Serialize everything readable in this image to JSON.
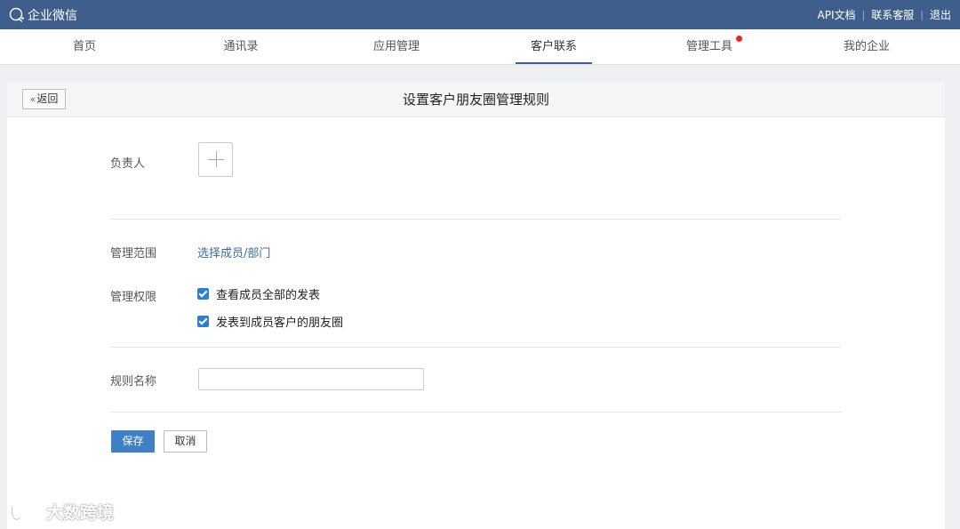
{
  "topbar": {
    "brand": "企业微信",
    "links": [
      "API文档",
      "联系客服",
      "退出"
    ]
  },
  "nav": {
    "items": [
      "首页",
      "通讯录",
      "应用管理",
      "客户联系",
      "管理工具",
      "我的企业"
    ],
    "active": "客户联系",
    "badge_on": "管理工具"
  },
  "page": {
    "back_label": "返回",
    "title": "设置客户朋友圈管理规则"
  },
  "form": {
    "owner_label": "负责人",
    "scope_label": "管理范围",
    "scope_link": "选择成员/部门",
    "permission_label": "管理权限",
    "permissions": [
      {
        "label": "查看成员全部的发表",
        "checked": true
      },
      {
        "label": "发表到成员客户的朋友圈",
        "checked": true
      }
    ],
    "rule_name_label": "规则名称",
    "rule_name_value": "",
    "save_label": "保存",
    "cancel_label": "取消"
  },
  "watermark": {
    "text": "大数跨境"
  },
  "colors": {
    "topbar": "#3e5f8c",
    "link": "#3e6aa3",
    "primary_button": "#3e7fc6",
    "checkbox": "#2f7fd1",
    "badge": "#ee2222"
  }
}
